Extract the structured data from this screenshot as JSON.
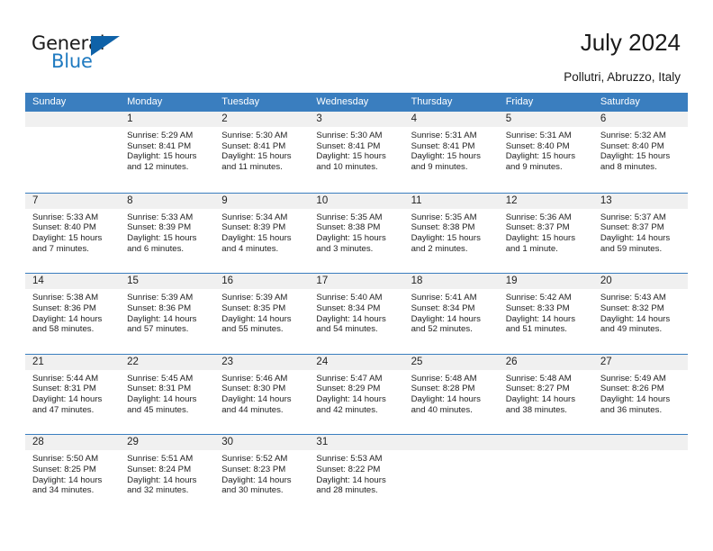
{
  "logo": {
    "word1": "General",
    "word2": "Blue",
    "flag_color": "#0f62a8",
    "blue_text_color": "#1f7ac0"
  },
  "header": {
    "title": "July 2024",
    "subtitle": "Pollutri, Abruzzo, Italy"
  },
  "theme": {
    "header_row_bg": "#3a7ebf",
    "daynum_bg": "#f0f0f0",
    "grid_line": "#3a7ebf"
  },
  "weekdays": [
    "Sunday",
    "Monday",
    "Tuesday",
    "Wednesday",
    "Thursday",
    "Friday",
    "Saturday"
  ],
  "weeks": [
    [
      {
        "day": "",
        "sunrise": "",
        "sunset": "",
        "daylight1": "",
        "daylight2": ""
      },
      {
        "day": "1",
        "sunrise": "Sunrise: 5:29 AM",
        "sunset": "Sunset: 8:41 PM",
        "daylight1": "Daylight: 15 hours",
        "daylight2": "and 12 minutes."
      },
      {
        "day": "2",
        "sunrise": "Sunrise: 5:30 AM",
        "sunset": "Sunset: 8:41 PM",
        "daylight1": "Daylight: 15 hours",
        "daylight2": "and 11 minutes."
      },
      {
        "day": "3",
        "sunrise": "Sunrise: 5:30 AM",
        "sunset": "Sunset: 8:41 PM",
        "daylight1": "Daylight: 15 hours",
        "daylight2": "and 10 minutes."
      },
      {
        "day": "4",
        "sunrise": "Sunrise: 5:31 AM",
        "sunset": "Sunset: 8:41 PM",
        "daylight1": "Daylight: 15 hours",
        "daylight2": "and 9 minutes."
      },
      {
        "day": "5",
        "sunrise": "Sunrise: 5:31 AM",
        "sunset": "Sunset: 8:40 PM",
        "daylight1": "Daylight: 15 hours",
        "daylight2": "and 9 minutes."
      },
      {
        "day": "6",
        "sunrise": "Sunrise: 5:32 AM",
        "sunset": "Sunset: 8:40 PM",
        "daylight1": "Daylight: 15 hours",
        "daylight2": "and 8 minutes."
      }
    ],
    [
      {
        "day": "7",
        "sunrise": "Sunrise: 5:33 AM",
        "sunset": "Sunset: 8:40 PM",
        "daylight1": "Daylight: 15 hours",
        "daylight2": "and 7 minutes."
      },
      {
        "day": "8",
        "sunrise": "Sunrise: 5:33 AM",
        "sunset": "Sunset: 8:39 PM",
        "daylight1": "Daylight: 15 hours",
        "daylight2": "and 6 minutes."
      },
      {
        "day": "9",
        "sunrise": "Sunrise: 5:34 AM",
        "sunset": "Sunset: 8:39 PM",
        "daylight1": "Daylight: 15 hours",
        "daylight2": "and 4 minutes."
      },
      {
        "day": "10",
        "sunrise": "Sunrise: 5:35 AM",
        "sunset": "Sunset: 8:38 PM",
        "daylight1": "Daylight: 15 hours",
        "daylight2": "and 3 minutes."
      },
      {
        "day": "11",
        "sunrise": "Sunrise: 5:35 AM",
        "sunset": "Sunset: 8:38 PM",
        "daylight1": "Daylight: 15 hours",
        "daylight2": "and 2 minutes."
      },
      {
        "day": "12",
        "sunrise": "Sunrise: 5:36 AM",
        "sunset": "Sunset: 8:37 PM",
        "daylight1": "Daylight: 15 hours",
        "daylight2": "and 1 minute."
      },
      {
        "day": "13",
        "sunrise": "Sunrise: 5:37 AM",
        "sunset": "Sunset: 8:37 PM",
        "daylight1": "Daylight: 14 hours",
        "daylight2": "and 59 minutes."
      }
    ],
    [
      {
        "day": "14",
        "sunrise": "Sunrise: 5:38 AM",
        "sunset": "Sunset: 8:36 PM",
        "daylight1": "Daylight: 14 hours",
        "daylight2": "and 58 minutes."
      },
      {
        "day": "15",
        "sunrise": "Sunrise: 5:39 AM",
        "sunset": "Sunset: 8:36 PM",
        "daylight1": "Daylight: 14 hours",
        "daylight2": "and 57 minutes."
      },
      {
        "day": "16",
        "sunrise": "Sunrise: 5:39 AM",
        "sunset": "Sunset: 8:35 PM",
        "daylight1": "Daylight: 14 hours",
        "daylight2": "and 55 minutes."
      },
      {
        "day": "17",
        "sunrise": "Sunrise: 5:40 AM",
        "sunset": "Sunset: 8:34 PM",
        "daylight1": "Daylight: 14 hours",
        "daylight2": "and 54 minutes."
      },
      {
        "day": "18",
        "sunrise": "Sunrise: 5:41 AM",
        "sunset": "Sunset: 8:34 PM",
        "daylight1": "Daylight: 14 hours",
        "daylight2": "and 52 minutes."
      },
      {
        "day": "19",
        "sunrise": "Sunrise: 5:42 AM",
        "sunset": "Sunset: 8:33 PM",
        "daylight1": "Daylight: 14 hours",
        "daylight2": "and 51 minutes."
      },
      {
        "day": "20",
        "sunrise": "Sunrise: 5:43 AM",
        "sunset": "Sunset: 8:32 PM",
        "daylight1": "Daylight: 14 hours",
        "daylight2": "and 49 minutes."
      }
    ],
    [
      {
        "day": "21",
        "sunrise": "Sunrise: 5:44 AM",
        "sunset": "Sunset: 8:31 PM",
        "daylight1": "Daylight: 14 hours",
        "daylight2": "and 47 minutes."
      },
      {
        "day": "22",
        "sunrise": "Sunrise: 5:45 AM",
        "sunset": "Sunset: 8:31 PM",
        "daylight1": "Daylight: 14 hours",
        "daylight2": "and 45 minutes."
      },
      {
        "day": "23",
        "sunrise": "Sunrise: 5:46 AM",
        "sunset": "Sunset: 8:30 PM",
        "daylight1": "Daylight: 14 hours",
        "daylight2": "and 44 minutes."
      },
      {
        "day": "24",
        "sunrise": "Sunrise: 5:47 AM",
        "sunset": "Sunset: 8:29 PM",
        "daylight1": "Daylight: 14 hours",
        "daylight2": "and 42 minutes."
      },
      {
        "day": "25",
        "sunrise": "Sunrise: 5:48 AM",
        "sunset": "Sunset: 8:28 PM",
        "daylight1": "Daylight: 14 hours",
        "daylight2": "and 40 minutes."
      },
      {
        "day": "26",
        "sunrise": "Sunrise: 5:48 AM",
        "sunset": "Sunset: 8:27 PM",
        "daylight1": "Daylight: 14 hours",
        "daylight2": "and 38 minutes."
      },
      {
        "day": "27",
        "sunrise": "Sunrise: 5:49 AM",
        "sunset": "Sunset: 8:26 PM",
        "daylight1": "Daylight: 14 hours",
        "daylight2": "and 36 minutes."
      }
    ],
    [
      {
        "day": "28",
        "sunrise": "Sunrise: 5:50 AM",
        "sunset": "Sunset: 8:25 PM",
        "daylight1": "Daylight: 14 hours",
        "daylight2": "and 34 minutes."
      },
      {
        "day": "29",
        "sunrise": "Sunrise: 5:51 AM",
        "sunset": "Sunset: 8:24 PM",
        "daylight1": "Daylight: 14 hours",
        "daylight2": "and 32 minutes."
      },
      {
        "day": "30",
        "sunrise": "Sunrise: 5:52 AM",
        "sunset": "Sunset: 8:23 PM",
        "daylight1": "Daylight: 14 hours",
        "daylight2": "and 30 minutes."
      },
      {
        "day": "31",
        "sunrise": "Sunrise: 5:53 AM",
        "sunset": "Sunset: 8:22 PM",
        "daylight1": "Daylight: 14 hours",
        "daylight2": "and 28 minutes."
      },
      {
        "day": "",
        "sunrise": "",
        "sunset": "",
        "daylight1": "",
        "daylight2": ""
      },
      {
        "day": "",
        "sunrise": "",
        "sunset": "",
        "daylight1": "",
        "daylight2": ""
      },
      {
        "day": "",
        "sunrise": "",
        "sunset": "",
        "daylight1": "",
        "daylight2": ""
      }
    ]
  ]
}
